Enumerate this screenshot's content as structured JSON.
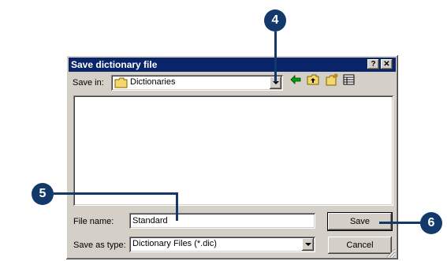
{
  "dialog": {
    "title": "Save dictionary file",
    "help_label": "?",
    "close_label": "✕",
    "save_in_label": "Save in:",
    "save_in_value": "Dictionaries",
    "file_name_label": "File name:",
    "file_name_value": "Standard",
    "save_as_type_label": "Save as type:",
    "save_as_type_value": "Dictionary Files (*.dic)",
    "save_button": "Save",
    "cancel_button": "Cancel"
  },
  "callouts": {
    "step4": "4",
    "step5": "5",
    "step6": "6"
  },
  "icons": {
    "folder": "folder-icon",
    "back": "back-arrow-icon",
    "up": "up-folder-icon",
    "new_folder": "new-folder-icon",
    "views": "view-menu-icon"
  },
  "colors": {
    "title_bar": "#0a246a",
    "callout": "#12396a",
    "dialog_face": "#d4d0c8"
  }
}
